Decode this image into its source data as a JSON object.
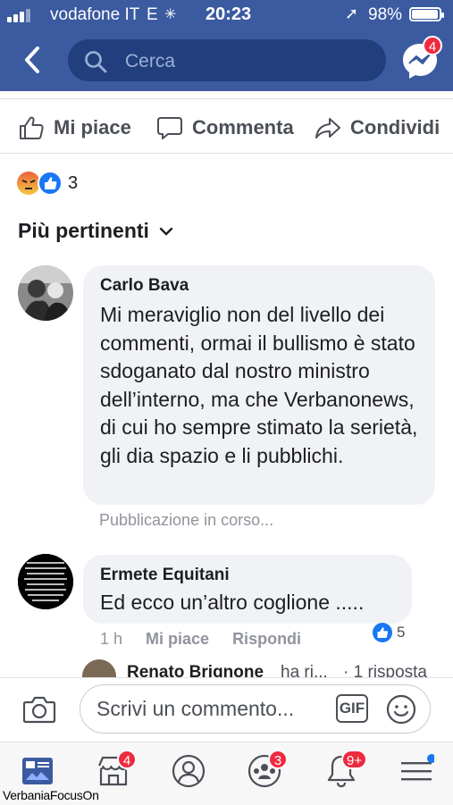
{
  "status_bar": {
    "carrier": "vodafone IT",
    "network": "E",
    "time": "20:23",
    "battery": "98%",
    "battery_level": 0.98
  },
  "header": {
    "search_placeholder": "Cerca",
    "messenger_badge": "4"
  },
  "actions": {
    "like": "Mi piace",
    "comment": "Commenta",
    "share": "Condividi"
  },
  "reactions": {
    "count": "3"
  },
  "sort": {
    "label": "Più pertinenti"
  },
  "comments": [
    {
      "author": "Carlo Bava",
      "text": "Mi meraviglio non del livello dei commenti, ormai il bullismo è stato sdoganato dal nostro ministro dell’interno, ma che Verbanonews, di cui ho sempre stimato la serietà, gli dia spazio e li pubblichi.",
      "status": "Pubblicazione in corso..."
    },
    {
      "author": "Ermete Equitani",
      "text": "Ed ecco un’altro coglione .....",
      "time": "1 h",
      "like_label": "Mi piace",
      "reply_label": "Rispondi",
      "like_count": "5",
      "avatar_text": "Quelli che: la pizza senza mozzarella, il cappuccino senza schiuma, la birra analcolica il gelato di soia. Cazzo vivete a fare!!"
    }
  ],
  "reply_preview": {
    "author": "Renato Brignone",
    "action": "ha ri...",
    "count": "· 1 risposta"
  },
  "composer": {
    "placeholder": "Scrivi un commento...",
    "gif_label": "GIF"
  },
  "tabbar": {
    "marketplace_badge": "4",
    "groups_badge": "3",
    "notifications_badge": "9+"
  },
  "watermark": "VerbaniaFocusOn",
  "colors": {
    "brand": "#3b5aa0",
    "search_bg": "#233e7c",
    "badge": "#ee2a3f",
    "bubble": "#f1f2f6",
    "like_blue": "#1877f2"
  }
}
